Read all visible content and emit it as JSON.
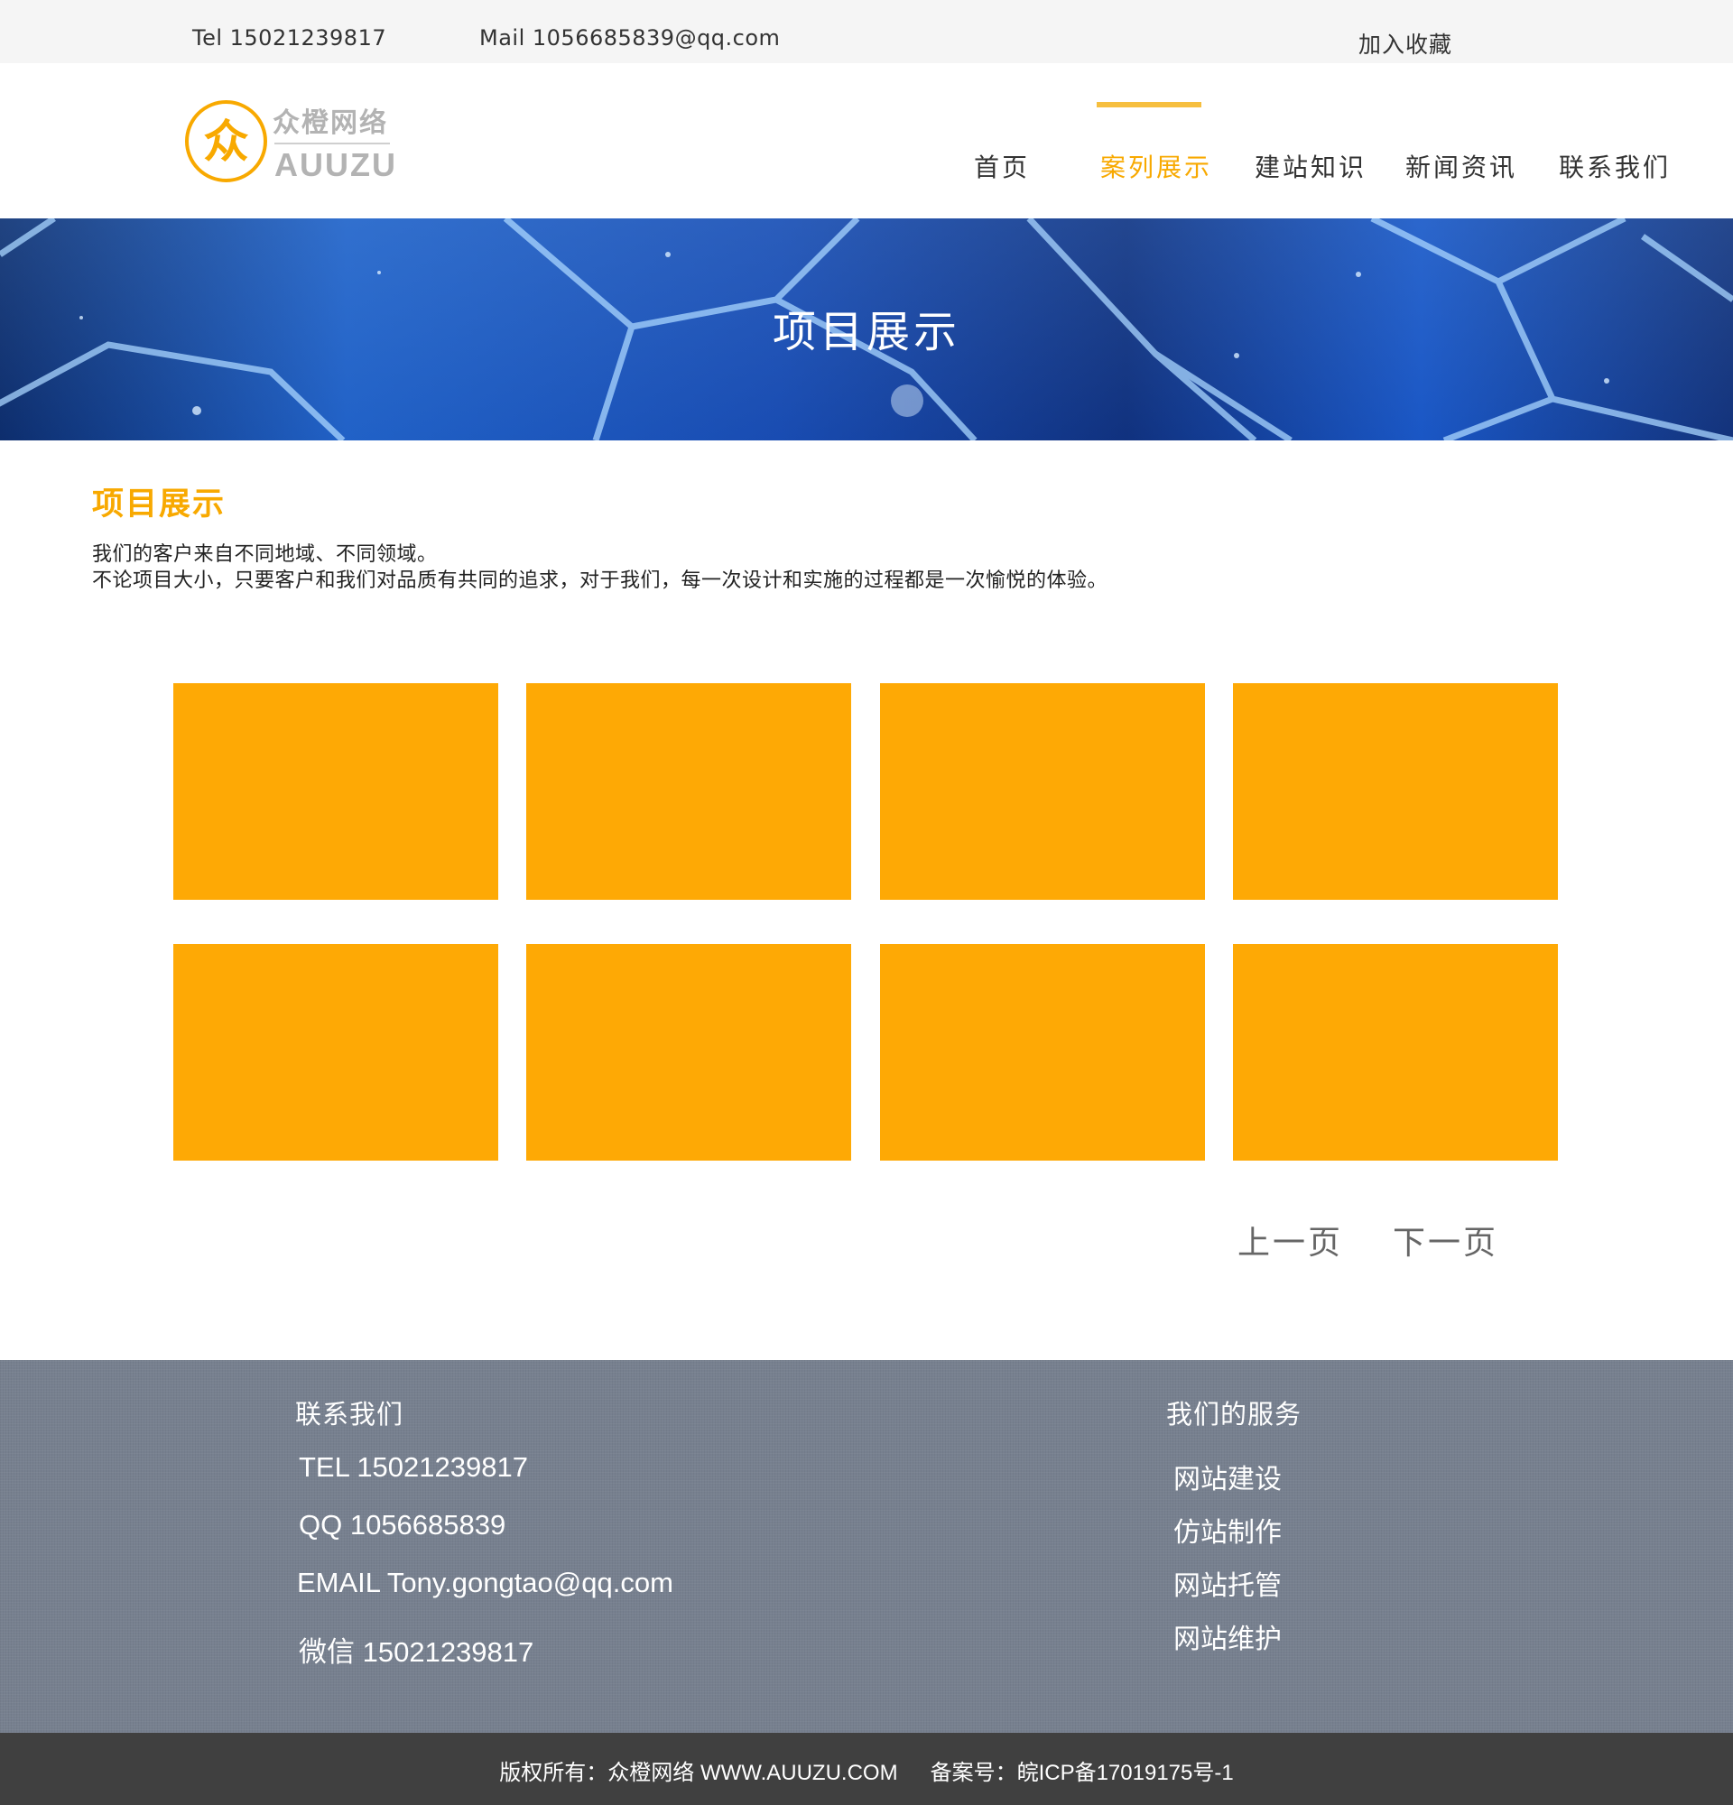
{
  "topbar": {
    "tel": "Tel 15021239817",
    "mail": "Mail 1056685839@qq.com",
    "favorite": "加入收藏"
  },
  "logo": {
    "glyph": "众",
    "cn": "众橙网络",
    "en": "AUUZU"
  },
  "nav": {
    "items": [
      {
        "label": "首页",
        "active": false
      },
      {
        "label": "案列展示",
        "active": true
      },
      {
        "label": "建站知识",
        "active": false
      },
      {
        "label": "新闻资讯",
        "active": false
      },
      {
        "label": "联系我们",
        "active": false
      }
    ]
  },
  "banner": {
    "title": "项目展示"
  },
  "main": {
    "title": "项目展示",
    "intro_line1": "我们的客户来自不同地域、不同领域。",
    "intro_line2": "不论项目大小，只要客户和我们对品质有共同的追求，对于我们，每一次设计和实施的过程都是一次愉悦的体验。",
    "card_count": 8,
    "card_color": "#fea905"
  },
  "pager": {
    "prev": "上一页",
    "next": "下一页"
  },
  "footer": {
    "contact_title": "联系我们",
    "tel": "TEL 15021239817",
    "qq": "QQ 1056685839",
    "email": "EMAIL Tony.gongtao@qq.com",
    "wechat": "微信 15021239817",
    "services_title": "我们的服务",
    "services": [
      "网站建设",
      "仿站制作",
      "网站托管",
      "网站维护"
    ]
  },
  "copyright": {
    "owner": "版权所有：众橙网络 WWW.AUUZU.COM",
    "icp": "备案号：皖ICP备17019175号-1"
  },
  "colors": {
    "accent": "#f8a900",
    "footer_bg": "#77808f",
    "copyright_bg": "#404040",
    "topbar_bg": "#f5f5f5"
  }
}
